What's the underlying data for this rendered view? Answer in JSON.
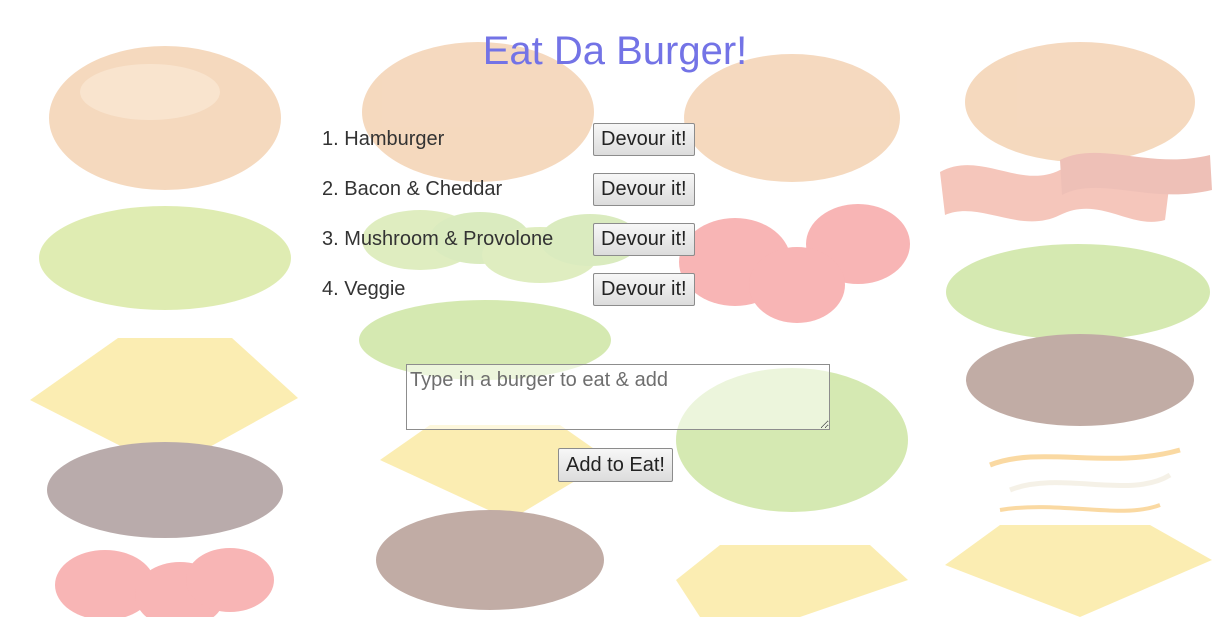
{
  "page": {
    "title": "Eat Da Burger!",
    "title_color": "#7373e6"
  },
  "burgers": [
    {
      "number": "1.",
      "name": "Hamburger",
      "button_label": "Devour it!"
    },
    {
      "number": "2.",
      "name": "Bacon & Cheddar",
      "button_label": "Devour it!"
    },
    {
      "number": "3.",
      "name": "Mushroom & Provolone",
      "button_label": "Devour it!"
    },
    {
      "number": "4.",
      "name": "Veggie",
      "button_label": "Devour it!"
    }
  ],
  "form": {
    "placeholder": "Type in a burger to eat & add",
    "value": "",
    "submit_label": "Add to Eat!"
  },
  "background": {
    "illustration": "burger-ingredients-pattern",
    "items": [
      "bun-icon",
      "lettuce-icon",
      "cheese-icon",
      "patty-icon",
      "tomato-icon",
      "cucumber-icon",
      "bacon-icon",
      "onion-icon"
    ]
  }
}
